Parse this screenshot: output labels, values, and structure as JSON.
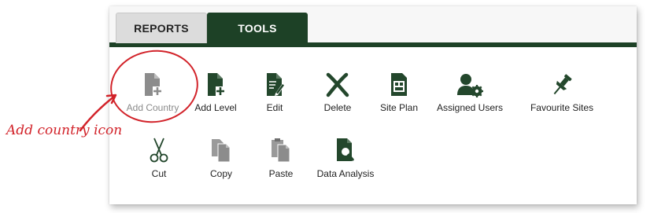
{
  "tabs": [
    {
      "label": "REPORTS",
      "active": false
    },
    {
      "label": "TOOLS",
      "active": true
    }
  ],
  "colors": {
    "accent": "#1d4126",
    "icon": "#23472c",
    "icon_disabled": "#8c8c8c",
    "annotation": "#d2232a"
  },
  "tools": {
    "row1": [
      {
        "label": "Add Country",
        "icon": "add-document-icon",
        "disabled": true
      },
      {
        "label": "Add Level",
        "icon": "add-document-icon",
        "disabled": false
      },
      {
        "label": "Edit",
        "icon": "edit-document-icon",
        "disabled": false
      },
      {
        "label": "Delete",
        "icon": "x-delete-icon",
        "disabled": false
      },
      {
        "label": "Site Plan",
        "icon": "site-plan-icon",
        "disabled": false
      },
      {
        "label": "Assigned Users",
        "icon": "user-gear-icon",
        "disabled": false
      },
      {
        "label": "Favourite Sites",
        "icon": "pushpin-icon",
        "disabled": false
      }
    ],
    "row2": [
      {
        "label": "Cut",
        "icon": "scissors-icon",
        "disabled": false
      },
      {
        "label": "Copy",
        "icon": "copy-documents-icon",
        "disabled": true
      },
      {
        "label": "Paste",
        "icon": "paste-documents-icon",
        "disabled": true
      },
      {
        "label": "Data Analysis",
        "icon": "document-magnifier-icon",
        "disabled": false
      }
    ]
  },
  "annotation": {
    "text": "Add country icon"
  }
}
